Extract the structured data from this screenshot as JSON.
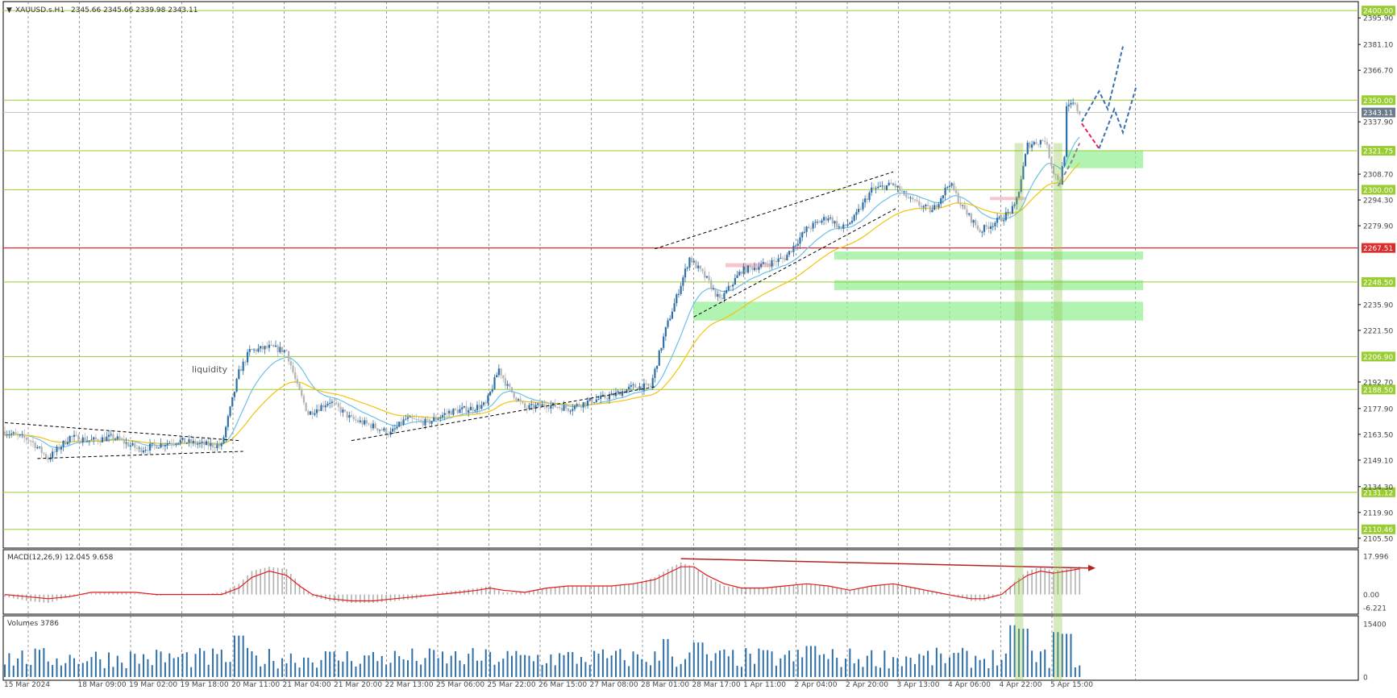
{
  "chart_header": {
    "menu_arrow": "▼",
    "symbol": "XAUUSD.s.H1",
    "ohlc": "2345.66 2345.66 2339.98 2343.11"
  },
  "annotations": {
    "liquidity": "liquidity"
  },
  "colors": {
    "bull": "#2f6fa8",
    "bear": "#b3b3b3",
    "level": "#9acd32",
    "red_level": "#dc2d2d",
    "zone": "#90ee90",
    "ema_fast": "#6cc0e8",
    "ema_slow": "#f1c40f",
    "macd_hist": "#b0b0b0",
    "macd_signal": "#e31a1c",
    "volume": "#2f6fa8",
    "projection_up": "#3a6fb0",
    "projection_down": "#e0245e"
  },
  "chart_data": [
    {
      "type": "candlestick",
      "title": "XAUUSD.s.H1",
      "ylim": [
        2100.0,
        2405.0
      ],
      "y_ticks": [
        "2395.90",
        "2381.10",
        "2366.70",
        "2337.90",
        "2308.70",
        "2294.30",
        "2279.90",
        "2235.90",
        "2221.50",
        "2192.70",
        "2177.90",
        "2163.50",
        "2149.10",
        "2134.30",
        "2119.90",
        "2105.50"
      ],
      "x_labels": [
        "15 Mar 2024",
        "18 Mar 09:00",
        "19 Mar 02:00",
        "19 Mar 18:00",
        "20 Mar 11:00",
        "21 Mar 04:00",
        "21 Mar 20:00",
        "22 Mar 13:00",
        "25 Mar 06:00",
        "25 Mar 22:00",
        "26 Mar 15:00",
        "27 Mar 08:00",
        "28 Mar 01:00",
        "28 Mar 17:00",
        "1 Apr 11:00",
        "2 Apr 04:00",
        "2 Apr 20:00",
        "3 Apr 13:00",
        "4 Apr 06:00",
        "4 Apr 22:00",
        "5 Apr 15:00"
      ],
      "price_levels": [
        {
          "value": 2400.0,
          "label": "2400.00",
          "kind": "green"
        },
        {
          "value": 2350.0,
          "label": "2350.00",
          "kind": "green"
        },
        {
          "value": 2343.11,
          "label": "2343.11",
          "kind": "current"
        },
        {
          "value": 2321.75,
          "label": "2321.75",
          "kind": "green"
        },
        {
          "value": 2300.0,
          "label": "2300.00",
          "kind": "green"
        },
        {
          "value": 2267.51,
          "label": "2267.51",
          "kind": "red"
        },
        {
          "value": 2248.5,
          "label": "2248.50",
          "kind": "green"
        },
        {
          "value": 2206.9,
          "label": "2206.90",
          "kind": "green"
        },
        {
          "value": 2188.5,
          "label": "2188.50",
          "kind": "green"
        },
        {
          "value": 2131.12,
          "label": "2131.12",
          "kind": "green"
        },
        {
          "value": 2110.46,
          "label": "2110.46",
          "kind": "green"
        }
      ],
      "zones": [
        {
          "from_label": "5 Apr 15:00",
          "y_low": 2312.0,
          "y_high": 2322.0
        },
        {
          "from_label": "1 Apr 11:00",
          "y_low": 2261.0,
          "y_high": 2265.5
        },
        {
          "from_label": "1 Apr 11:00",
          "y_low": 2244.0,
          "y_high": 2249.5
        },
        {
          "from_label": "28 Mar 17:00",
          "y_low": 2227.0,
          "y_high": 2237.5
        }
      ],
      "series_path": [
        [
          0,
          2165
        ],
        [
          12,
          2160
        ],
        [
          20,
          2150
        ],
        [
          30,
          2162
        ],
        [
          40,
          2160
        ],
        [
          50,
          2162
        ],
        [
          62,
          2155
        ],
        [
          72,
          2158
        ],
        [
          80,
          2160
        ],
        [
          90,
          2158
        ],
        [
          100,
          2157
        ],
        [
          108,
          2198
        ],
        [
          113,
          2210
        ],
        [
          122,
          2212
        ],
        [
          130,
          2210
        ],
        [
          135,
          2190
        ],
        [
          140,
          2175
        ],
        [
          150,
          2182
        ],
        [
          160,
          2172
        ],
        [
          170,
          2168
        ],
        [
          178,
          2164
        ],
        [
          185,
          2172
        ],
        [
          195,
          2170
        ],
        [
          205,
          2176
        ],
        [
          215,
          2178
        ],
        [
          222,
          2180
        ],
        [
          228,
          2200
        ],
        [
          232,
          2190
        ],
        [
          240,
          2178
        ],
        [
          250,
          2180
        ],
        [
          260,
          2178
        ],
        [
          270,
          2182
        ],
        [
          280,
          2185
        ],
        [
          290,
          2190
        ],
        [
          298,
          2190
        ],
        [
          305,
          2222
        ],
        [
          310,
          2240
        ],
        [
          316,
          2262
        ],
        [
          324,
          2250
        ],
        [
          330,
          2238
        ],
        [
          340,
          2255
        ],
        [
          350,
          2258
        ],
        [
          360,
          2262
        ],
        [
          370,
          2278
        ],
        [
          380,
          2285
        ],
        [
          386,
          2278
        ],
        [
          392,
          2284
        ],
        [
          400,
          2300
        ],
        [
          410,
          2303
        ],
        [
          418,
          2294
        ],
        [
          428,
          2288
        ],
        [
          436,
          2304
        ],
        [
          442,
          2290
        ],
        [
          450,
          2277
        ],
        [
          460,
          2284
        ],
        [
          466,
          2290
        ],
        [
          468,
          2300
        ],
        [
          472,
          2325
        ],
        [
          480,
          2328
        ],
        [
          484,
          2310
        ],
        [
          487,
          2304
        ],
        [
          489,
          2320
        ],
        [
          490,
          2345
        ],
        [
          493,
          2348
        ],
        [
          496,
          2343
        ]
      ]
    },
    {
      "type": "line",
      "title": "MACD(12,26,9) 12.045 9.658",
      "ylim": [
        -6.221,
        17.996
      ],
      "y_ticks": [
        "17.996",
        "0.00",
        "-6.221"
      ],
      "series": [
        {
          "name": "histogram",
          "values": [
            [
              0,
              -1
            ],
            [
              10,
              -3
            ],
            [
              20,
              -4
            ],
            [
              30,
              -1
            ],
            [
              40,
              0.5
            ],
            [
              50,
              1
            ],
            [
              60,
              0.5
            ],
            [
              70,
              -0.5
            ],
            [
              80,
              0
            ],
            [
              90,
              0
            ],
            [
              100,
              1
            ],
            [
              108,
              5
            ],
            [
              114,
              11
            ],
            [
              122,
              13
            ],
            [
              130,
              12
            ],
            [
              136,
              5
            ],
            [
              142,
              -1
            ],
            [
              150,
              -3
            ],
            [
              160,
              -4
            ],
            [
              170,
              -4
            ],
            [
              180,
              -3
            ],
            [
              190,
              -2
            ],
            [
              200,
              1
            ],
            [
              210,
              2
            ],
            [
              218,
              3
            ],
            [
              224,
              4
            ],
            [
              230,
              1
            ],
            [
              240,
              1
            ],
            [
              250,
              3
            ],
            [
              260,
              4
            ],
            [
              270,
              4
            ],
            [
              280,
              4
            ],
            [
              290,
              5
            ],
            [
              300,
              8
            ],
            [
              306,
              12
            ],
            [
              312,
              15
            ],
            [
              318,
              13
            ],
            [
              324,
              8
            ],
            [
              332,
              4
            ],
            [
              340,
              3
            ],
            [
              350,
              3
            ],
            [
              360,
              4
            ],
            [
              370,
              5
            ],
            [
              380,
              4
            ],
            [
              390,
              2
            ],
            [
              400,
              4
            ],
            [
              410,
              5
            ],
            [
              420,
              3
            ],
            [
              430,
              1
            ],
            [
              440,
              -1
            ],
            [
              446,
              -3
            ],
            [
              452,
              -3
            ],
            [
              460,
              0
            ],
            [
              466,
              6
            ],
            [
              472,
              11
            ],
            [
              478,
              13
            ],
            [
              484,
              11
            ],
            [
              490,
              12
            ],
            [
              496,
              13
            ]
          ]
        },
        {
          "name": "signal",
          "values": [
            [
              0,
              0
            ],
            [
              10,
              -1
            ],
            [
              20,
              -2
            ],
            [
              30,
              -1
            ],
            [
              40,
              1
            ],
            [
              50,
              1
            ],
            [
              60,
              1
            ],
            [
              70,
              0
            ],
            [
              80,
              0
            ],
            [
              90,
              0
            ],
            [
              100,
              0
            ],
            [
              108,
              3
            ],
            [
              114,
              8
            ],
            [
              122,
              11
            ],
            [
              130,
              9
            ],
            [
              136,
              4
            ],
            [
              142,
              0
            ],
            [
              150,
              -2
            ],
            [
              160,
              -3
            ],
            [
              170,
              -3
            ],
            [
              180,
              -2
            ],
            [
              190,
              -1
            ],
            [
              200,
              0
            ],
            [
              210,
              1
            ],
            [
              218,
              2
            ],
            [
              224,
              3
            ],
            [
              230,
              2
            ],
            [
              240,
              1
            ],
            [
              250,
              3
            ],
            [
              260,
              4
            ],
            [
              270,
              4
            ],
            [
              280,
              4
            ],
            [
              290,
              5
            ],
            [
              300,
              7
            ],
            [
              306,
              10
            ],
            [
              312,
              13
            ],
            [
              318,
              13
            ],
            [
              324,
              9
            ],
            [
              332,
              5
            ],
            [
              340,
              3
            ],
            [
              350,
              3
            ],
            [
              360,
              4
            ],
            [
              370,
              5
            ],
            [
              380,
              4
            ],
            [
              390,
              2
            ],
            [
              400,
              4
            ],
            [
              410,
              5
            ],
            [
              420,
              3
            ],
            [
              430,
              1
            ],
            [
              440,
              -1
            ],
            [
              446,
              -2
            ],
            [
              452,
              -2
            ],
            [
              460,
              0
            ],
            [
              466,
              5
            ],
            [
              472,
              9
            ],
            [
              478,
              11
            ],
            [
              484,
              10
            ],
            [
              490,
              11
            ],
            [
              496,
              12
            ]
          ]
        }
      ]
    },
    {
      "type": "bar",
      "title": "Volumes 3786",
      "ylim": [
        0,
        15400
      ],
      "y_ticks": [
        "15400",
        "0"
      ]
    }
  ]
}
